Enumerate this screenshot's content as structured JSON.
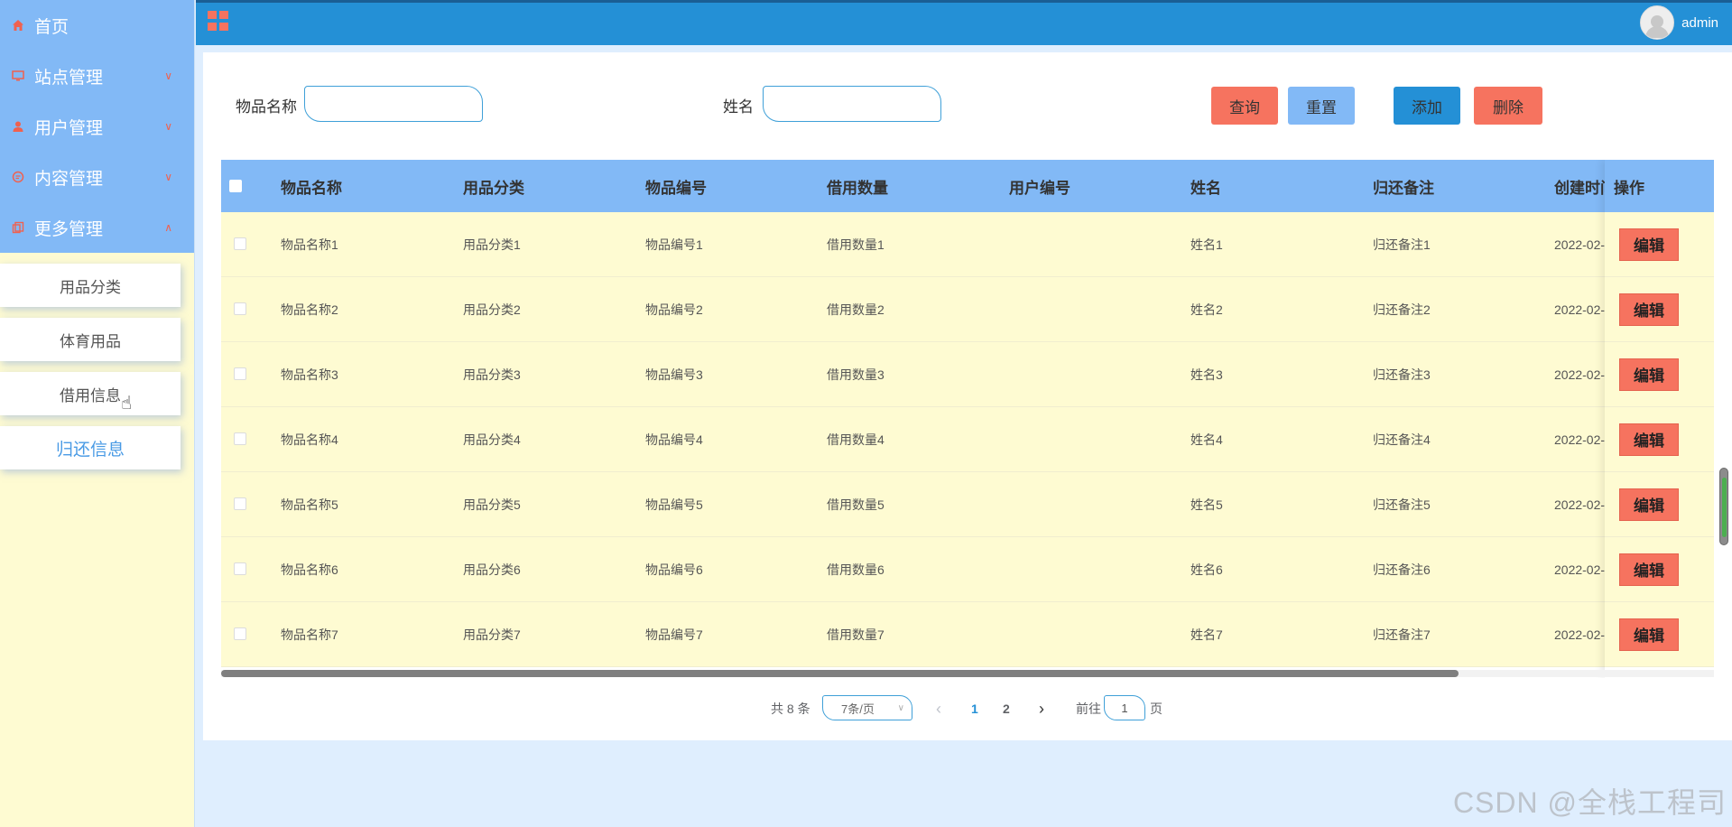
{
  "sidebar": {
    "menu": [
      {
        "label": "首页",
        "icon": "home-icon",
        "arrow": ""
      },
      {
        "label": "站点管理",
        "icon": "monitor-icon",
        "arrow": "∨"
      },
      {
        "label": "用户管理",
        "icon": "user-icon",
        "arrow": "∨"
      },
      {
        "label": "内容管理",
        "icon": "chat-icon",
        "arrow": "∨"
      },
      {
        "label": "更多管理",
        "icon": "copy-icon",
        "arrow": "∧"
      }
    ],
    "sub_items": [
      {
        "label": "用品分类"
      },
      {
        "label": "体育用品"
      },
      {
        "label": "借用信息"
      },
      {
        "label": "归还信息"
      }
    ]
  },
  "topbar": {
    "user_name": "admin"
  },
  "search": {
    "field1_label": "物品名称",
    "field1_value": "",
    "field2_label": "姓名",
    "field2_value": "",
    "query_label": "查询",
    "reset_label": "重置",
    "add_label": "添加",
    "delete_label": "删除"
  },
  "table": {
    "columns": [
      "物品名称",
      "用品分类",
      "物品编号",
      "借用数量",
      "用户编号",
      "姓名",
      "归还备注",
      "创建时间",
      "操作"
    ],
    "rows": [
      [
        "物品名称1",
        "用品分类1",
        "物品编号1",
        "借用数量1",
        "",
        "姓名1",
        "归还备注1",
        "2022-02-"
      ],
      [
        "物品名称2",
        "用品分类2",
        "物品编号2",
        "借用数量2",
        "",
        "姓名2",
        "归还备注2",
        "2022-02-"
      ],
      [
        "物品名称3",
        "用品分类3",
        "物品编号3",
        "借用数量3",
        "",
        "姓名3",
        "归还备注3",
        "2022-02-"
      ],
      [
        "物品名称4",
        "用品分类4",
        "物品编号4",
        "借用数量4",
        "",
        "姓名4",
        "归还备注4",
        "2022-02-"
      ],
      [
        "物品名称5",
        "用品分类5",
        "物品编号5",
        "借用数量5",
        "",
        "姓名5",
        "归还备注5",
        "2022-02-"
      ],
      [
        "物品名称6",
        "用品分类6",
        "物品编号6",
        "借用数量6",
        "",
        "姓名6",
        "归还备注6",
        "2022-02-"
      ],
      [
        "物品名称7",
        "用品分类7",
        "物品编号7",
        "借用数量7",
        "",
        "姓名7",
        "归还备注7",
        "2022-02-"
      ]
    ],
    "edit_label": "编辑"
  },
  "pagination": {
    "total": "共 8 条",
    "page_size": "7条/页",
    "prev": "‹",
    "pages": [
      "1",
      "2"
    ],
    "next": "›",
    "goto_prefix": "前往",
    "goto_value": "1",
    "goto_suffix": "页"
  },
  "watermark": "CSDN @全栈工程司",
  "colors": {
    "primary": "#2490d6",
    "light_blue": "#82b9f6",
    "coral": "#f6735f",
    "cream": "#fefbd2"
  }
}
